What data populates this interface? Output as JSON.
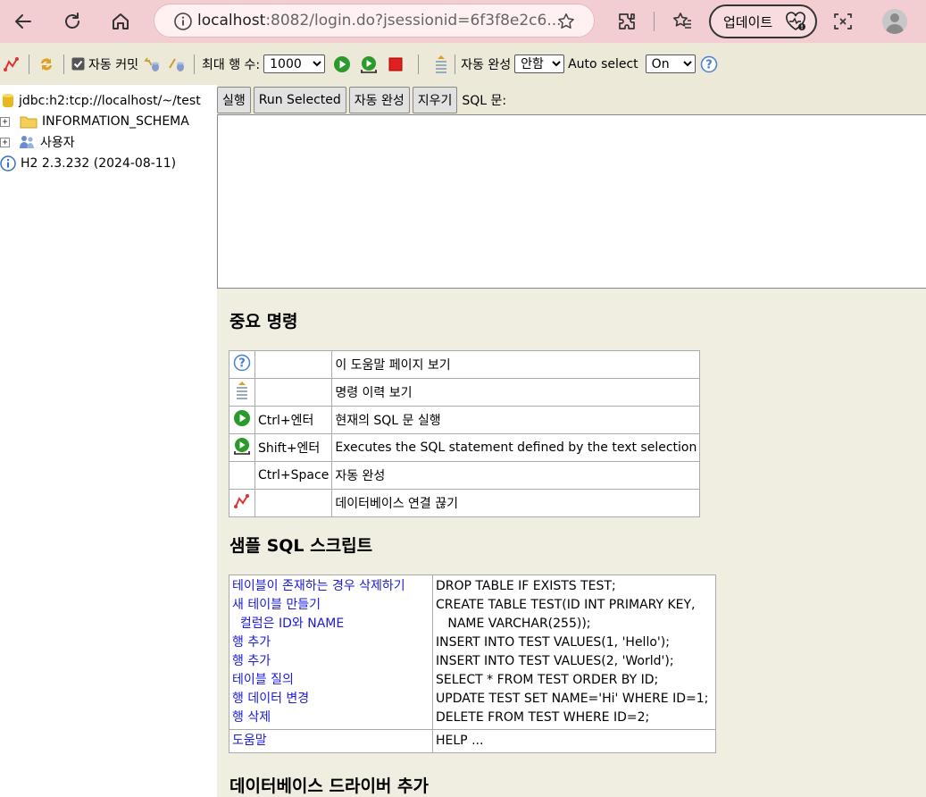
{
  "browser": {
    "url_host": "localhost",
    "url_rest": ":8082/login.do?jsessionid=6f3f8e2c6...",
    "update_label": "업데이트",
    "icons": [
      "back-icon",
      "refresh-icon",
      "home-icon",
      "info-icon",
      "star-icon",
      "extensions-icon",
      "favorites-icon",
      "screenshot-icon",
      "profile-icon"
    ]
  },
  "toolbar": {
    "autocommit_label": "자동 커밋",
    "autocommit_checked": true,
    "max_rows_label": "최대 행 수:",
    "max_rows_value": "1000",
    "autocomplete_label": "자동 완성",
    "autocomplete_value": "안함",
    "autoselect_label": "Auto select",
    "autoselect_value": "On"
  },
  "tree": {
    "connection": "jdbc:h2:tcp://localhost/~/test",
    "schema": "INFORMATION_SCHEMA",
    "users": "사용자",
    "version": "H2 2.3.232 (2024-08-11)"
  },
  "query": {
    "run": "실행",
    "run_selected": "Run Selected",
    "autocomplete": "자동 완성",
    "clear": "지우기",
    "sql_label": "SQL 문:",
    "sql_text": ""
  },
  "help": {
    "important_title": "중요 명령",
    "commands": [
      {
        "icon": "help-icon",
        "key": "",
        "desc": "이 도움말 페이지 보기"
      },
      {
        "icon": "history-icon",
        "key": "",
        "desc": "명령 이력 보기"
      },
      {
        "icon": "run-icon",
        "key": "Ctrl+엔터",
        "desc": "현재의 SQL 문 실행"
      },
      {
        "icon": "run-selected-icon",
        "key": "Shift+엔터",
        "desc": "Executes the SQL statement defined by the text selection"
      },
      {
        "icon": "",
        "key": "Ctrl+Space",
        "desc": "자동 완성"
      },
      {
        "icon": "disconnect-icon",
        "key": "",
        "desc": "데이터베이스 연결 끊기"
      }
    ],
    "sample_title": "샘플 SQL 스크립트",
    "samples": [
      {
        "link": "테이블이 존재하는 경우 삭제하기",
        "sql": "DROP TABLE IF EXISTS TEST;"
      },
      {
        "link": "새 테이블 만들기",
        "sql": "CREATE TABLE TEST(ID INT PRIMARY KEY,"
      },
      {
        "link": "  컬럼은 ID와 NAME",
        "sql": "   NAME VARCHAR(255));"
      },
      {
        "link": "행 추가",
        "sql": "INSERT INTO TEST VALUES(1, 'Hello');"
      },
      {
        "link": "행 추가",
        "sql": "INSERT INTO TEST VALUES(2, 'World');"
      },
      {
        "link": "테이블 질의",
        "sql": "SELECT * FROM TEST ORDER BY ID;"
      },
      {
        "link": "행 데이터 변경",
        "sql": "UPDATE TEST SET NAME='Hi' WHERE ID=1;"
      },
      {
        "link": "행 삭제",
        "sql": "DELETE FROM TEST WHERE ID=2;"
      }
    ],
    "help_link": "도움말",
    "help_sql": "HELP ...",
    "driver_title": "데이터베이스 드라이버 추가"
  }
}
